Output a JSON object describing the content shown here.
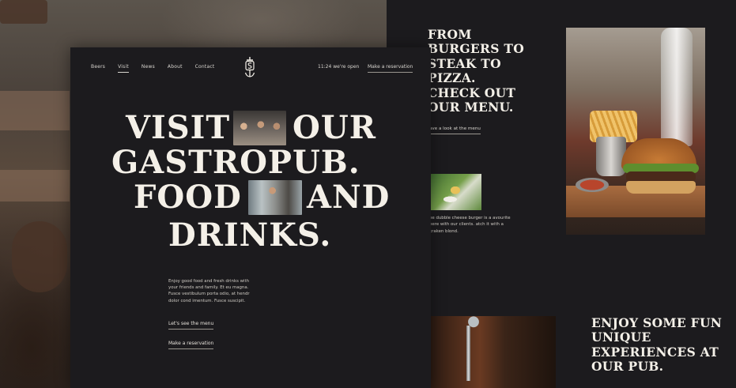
{
  "nav": {
    "items": [
      {
        "label": "Beers",
        "active": false
      },
      {
        "label": "Visit",
        "active": true
      },
      {
        "label": "News",
        "active": false
      },
      {
        "label": "About",
        "active": false
      },
      {
        "label": "Contact",
        "active": false
      }
    ],
    "time_status": "11:24 we're open",
    "reserve_label": "Make a reservation"
  },
  "hero": {
    "line1_a": "VISIT",
    "line1_b": "OUR",
    "line2": "GASTROPUB.",
    "line3_a": "FOOD",
    "line3_b": "AND",
    "line4": "DRINKS."
  },
  "intro": {
    "text": "Enjoy good food and fresh drinks with your friends and family. Et eu magna. Fusce vestibulum porta odio, at hendr dolor cond imentum. Fusce suscipit.",
    "cta_menu": "Let's see the menu",
    "cta_reserve": "Make a reservation"
  },
  "right": {
    "headline": "FROM BURGERS TO STEAK TO PIZZA. CHECK OUT OUR MENU.",
    "menu_link": "ave a look at the menu",
    "burger_text": "he dubble cheese burger is a avourite here with our clients. atch it with a kraken blond.",
    "headline2": "ENJOY SOME FUN UNIQUE EXPERIENCES AT OUR PUB."
  },
  "colors": {
    "page_bg": "#1c1b1e",
    "text": "#f4f0e8",
    "muted": "#cfcbc4"
  }
}
